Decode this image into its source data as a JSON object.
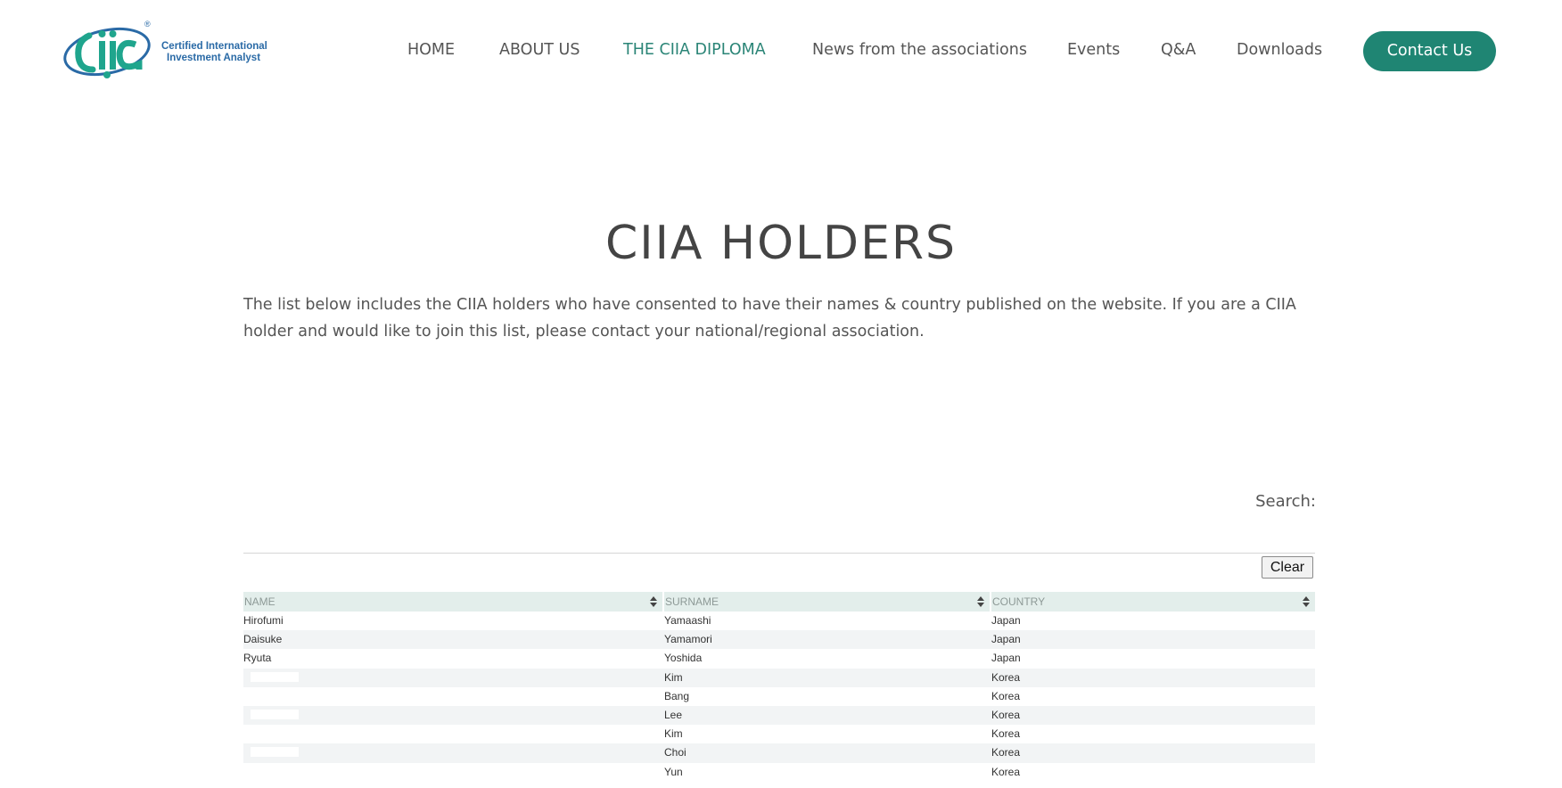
{
  "logo": {
    "mark_text": "ciia",
    "registered": "®",
    "line1": "Certified International",
    "line2": "Investment Analyst"
  },
  "nav": {
    "items": [
      {
        "label": "HOME",
        "active": false
      },
      {
        "label": "ABOUT US",
        "active": false
      },
      {
        "label": "THE CIIA DIPLOMA",
        "active": true
      },
      {
        "label": "News from the associations",
        "active": false
      },
      {
        "label": "Events",
        "active": false
      },
      {
        "label": "Q&A",
        "active": false
      },
      {
        "label": "Downloads",
        "active": false
      }
    ],
    "contact_label": "Contact Us"
  },
  "page": {
    "title": "CIIA HOLDERS",
    "intro": "The list below includes the CIIA holders who have consented to have their names & country published on the website. If you are a CIIA holder and would like to join this list, please contact your national/regional association."
  },
  "search": {
    "label": "Search:",
    "value": "",
    "clear_label": "Clear"
  },
  "table": {
    "columns": [
      "NAME",
      "SURNAME",
      "COUNTRY"
    ],
    "rows": [
      {
        "name": "Hirofumi",
        "surname": "Yamaashi",
        "country": "Japan",
        "redacted": false
      },
      {
        "name": "Daisuke",
        "surname": "Yamamori",
        "country": "Japan",
        "redacted": false
      },
      {
        "name": "Ryuta",
        "surname": "Yoshida",
        "country": "Japan",
        "redacted": false
      },
      {
        "name": "",
        "surname": "Kim",
        "country": "Korea",
        "redacted": true
      },
      {
        "name": "",
        "surname": "Bang",
        "country": "Korea",
        "redacted": true
      },
      {
        "name": "",
        "surname": "Lee",
        "country": "Korea",
        "redacted": true
      },
      {
        "name": "",
        "surname": "Kim",
        "country": "Korea",
        "redacted": true
      },
      {
        "name": "",
        "surname": "Choi",
        "country": "Korea",
        "redacted": true
      },
      {
        "name": "",
        "surname": "Yun",
        "country": "Korea",
        "redacted": true
      }
    ]
  },
  "colors": {
    "accent": "#1f8573",
    "active_nav": "#2b8577",
    "text": "#555555",
    "logo_blue": "#2a6aa6",
    "header_row": "#e3eeeb",
    "alt_row": "#f2f4f5"
  }
}
